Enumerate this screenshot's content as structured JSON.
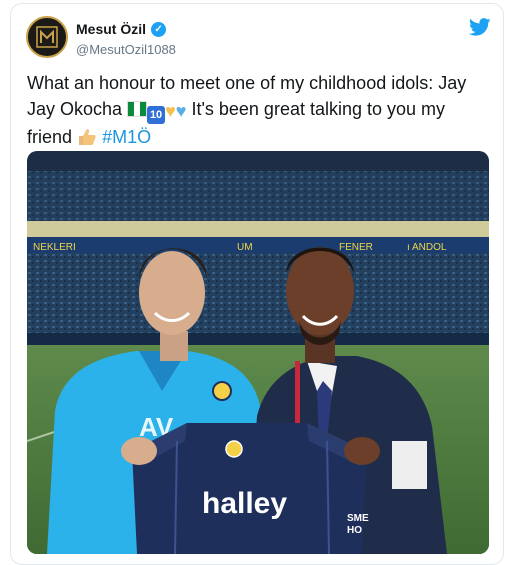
{
  "author": {
    "display_name": "Mesut Özil",
    "handle": "@MesutOzil1088",
    "avatar_icon": "m10-logo-icon",
    "verified_icon": "verified-badge-icon"
  },
  "platform_icon": "twitter-bird-icon",
  "tweet": {
    "text_line1": "What an honour to meet one of my childhood idols: Jay Jay Okocha",
    "text_line2": "It's been great talking to you my friend",
    "hashtag": "#M1Ö",
    "emoji_10": "10"
  },
  "photo": {
    "stadium_sign_1": "NEKLERI",
    "stadium_sign_2": "UM",
    "stadium_sign_3": "FENER",
    "stadium_sign_4": "ı ANDOL",
    "sleeve_text": "AV",
    "shirt_sponsor": "halley",
    "shirt_side_text_1": "SME",
    "shirt_side_text_2": "HO"
  },
  "colors": {
    "accent": "#1da1f2",
    "hashtag": "#1b95e0",
    "jersey_blue": "#1f2f5c",
    "jacket_blue": "#2bb2ea",
    "suit": "#1f2d4a"
  }
}
